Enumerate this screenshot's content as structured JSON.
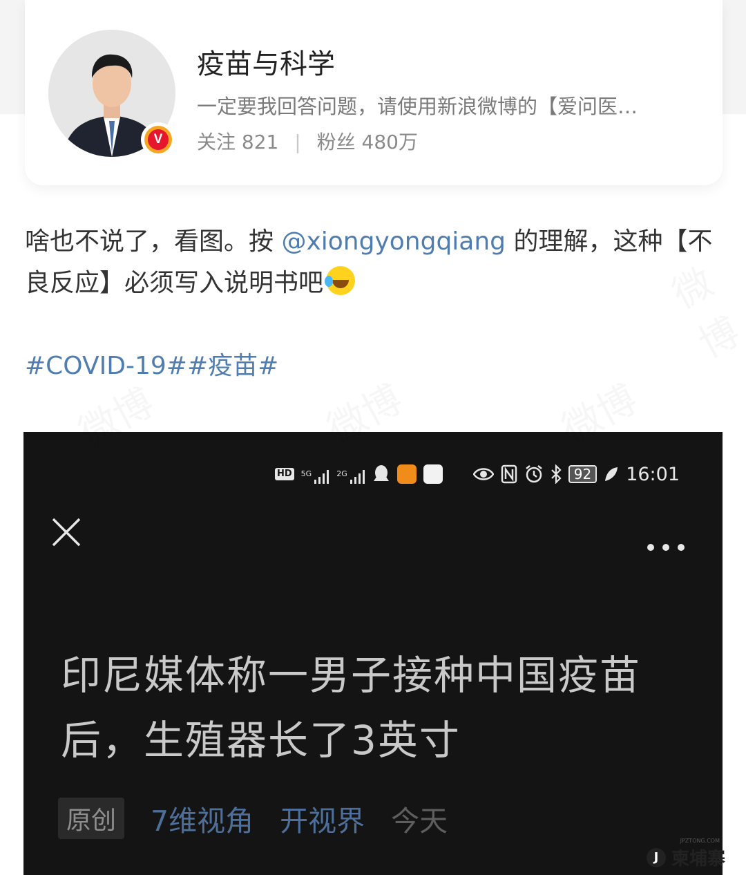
{
  "profile": {
    "name": "疫苗与科学",
    "description": "一定要我回答问题，请使用新浪微博的【爱问医…",
    "following_label": "关注",
    "following_count": "821",
    "followers_label": "粉丝",
    "followers_count": "480万",
    "verified_badge": "V"
  },
  "post": {
    "text_before": "啥也不说了，看图。按 ",
    "mention": "@xiongyongqiang",
    "text_after": " 的理解，这种【不良反应】必须写入说明书吧",
    "emoji": "laugh-cry-icon",
    "hashtags": [
      "#COVID-19#",
      "#疫苗#"
    ]
  },
  "embedded_screenshot": {
    "status_bar": {
      "hd": "HD",
      "net1": "5G",
      "net2": "2G",
      "battery": "92",
      "time": "16:01"
    },
    "article_title": "印尼媒体称一男子接种中国疫苗后，生殖器长了3英寸",
    "original_badge": "原创",
    "source_account": "7维视角",
    "source_channel": "开视界",
    "time": "今天"
  },
  "watermark": {
    "text": "微博",
    "site": "JPZTONG.COM",
    "logo": "柬埔寨"
  },
  "colors": {
    "link": "#507daf",
    "embed_bg": "#141414",
    "verified_red": "#e6162d"
  }
}
